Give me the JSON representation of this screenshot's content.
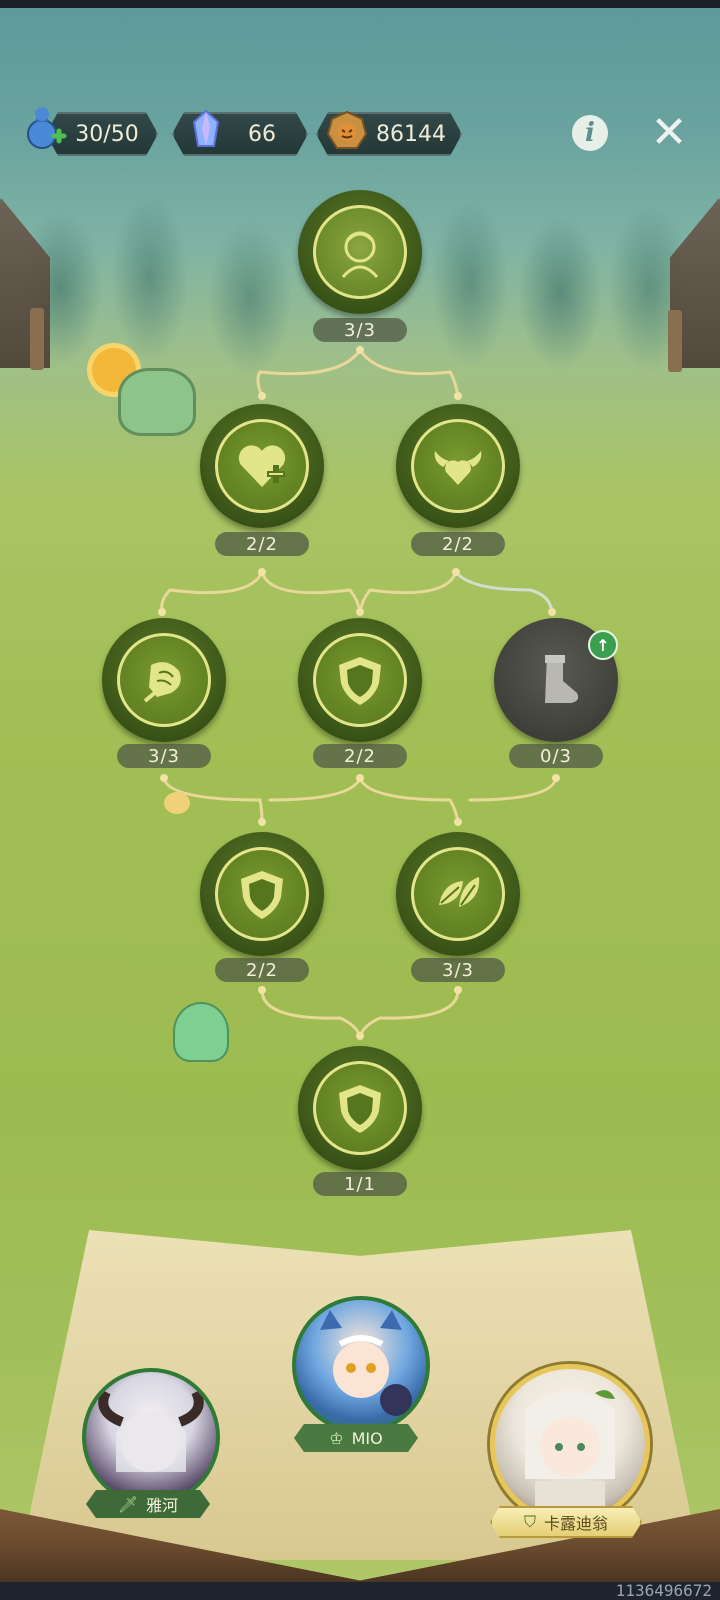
{
  "hud": {
    "stamina": "30/50",
    "gems": "66",
    "gold": "86144"
  },
  "nodes": [
    {
      "progress": "3/3",
      "icon": "portrait-icon",
      "state": "completed"
    },
    {
      "progress": "2/2",
      "icon": "heart-plus-icon",
      "state": "completed"
    },
    {
      "progress": "2/2",
      "icon": "winged-heart-icon",
      "state": "completed"
    },
    {
      "progress": "3/3",
      "icon": "rose-icon",
      "state": "completed"
    },
    {
      "progress": "2/2",
      "icon": "shield-icon",
      "state": "completed"
    },
    {
      "progress": "0/3",
      "icon": "boot-icon",
      "state": "locked"
    },
    {
      "progress": "2/2",
      "icon": "shield-icon",
      "state": "completed"
    },
    {
      "progress": "3/3",
      "icon": "leaf-icon",
      "state": "completed"
    },
    {
      "progress": "1/1",
      "icon": "shield-icon",
      "state": "completed"
    }
  ],
  "characters": [
    {
      "name": "雅河",
      "role_icon": "sword-icon"
    },
    {
      "name": "MIO",
      "role_icon": "crown-icon"
    },
    {
      "name": "卡露迪翁",
      "role_icon": "shield-icon",
      "selected": true
    }
  ],
  "footer": {
    "id_text": "1136496672"
  },
  "colors": {
    "node_active": "#4f6c1f",
    "node_ring": "#e3e58a",
    "node_locked": "#4a4a45",
    "badge_bg": "#5a6446",
    "upgrade": "#3aa050"
  }
}
